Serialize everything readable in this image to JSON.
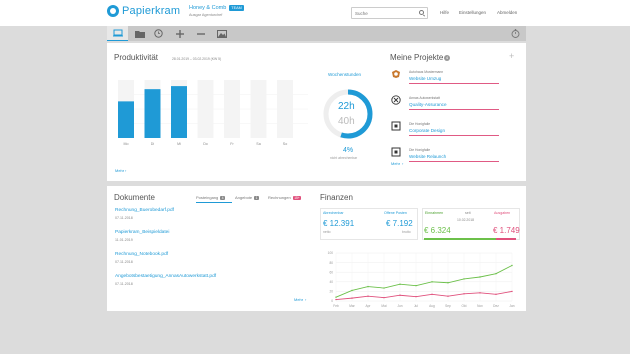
{
  "app": {
    "name": "Papierkram"
  },
  "company": {
    "name": "Honey & Comb",
    "plan": "TEAM",
    "subtitle": "Ausgar Agenturchef"
  },
  "search": {
    "placeholder": "Suche"
  },
  "nav": {
    "help": "Hilfe",
    "settings": "Einstellungen",
    "logout": "Abmelden"
  },
  "toolbar": {
    "icons": [
      "monitor-icon",
      "folder-icon",
      "clock-icon",
      "plus-icon",
      "minus-icon",
      "image-icon",
      "stopwatch-icon"
    ]
  },
  "productivity": {
    "title": "Produktivität",
    "range": "28.01.2019 – 03.02.2019 (KW 5)",
    "more": "Mehr",
    "weekly_title": "Wochenstunden",
    "hours_done": "22h",
    "hours_target": "40h",
    "percent": "4%",
    "percent_label": "nicht abrechenbar",
    "donut_fraction": 0.55
  },
  "chart_data": [
    {
      "type": "bar",
      "categories": [
        "Mo",
        "Di",
        "Mi",
        "Do",
        "Fr",
        "Sa",
        "So"
      ],
      "series": [
        {
          "values": [
            6,
            8,
            8.5,
            0,
            0,
            0,
            0
          ]
        }
      ],
      "ylim": [
        0,
        9.5
      ],
      "grid": true
    },
    {
      "type": "line",
      "categories": [
        "Feb",
        "Mar",
        "Apr",
        "Mai",
        "Jun",
        "Jul",
        "Aug",
        "Sep",
        "Okt",
        "Nov",
        "Dez",
        "Jan"
      ],
      "y_ticks": [
        0,
        20,
        40,
        60,
        80,
        100
      ],
      "series": [
        {
          "values": [
            8,
            22,
            30,
            27,
            35,
            32,
            40,
            38,
            46,
            50,
            57,
            74
          ]
        },
        {
          "values": [
            3,
            6,
            10,
            7,
            12,
            9,
            14,
            10,
            15,
            17,
            14,
            20
          ]
        }
      ],
      "ylim": [
        0,
        100
      ],
      "grid": true
    }
  ],
  "projects": {
    "title": "Meine Projekte",
    "count": "4",
    "more": "Mehr",
    "items": [
      {
        "client": "Autohaus Mustermann",
        "name": "Website Umzug"
      },
      {
        "client": "Annas Autowerkstatt",
        "name": "Quality-Assurance"
      },
      {
        "client": "Die Honigfalle",
        "name": "Corporate Design"
      },
      {
        "client": "Die Honigfalle",
        "name": "Website Relaunch"
      }
    ]
  },
  "documents": {
    "title": "Dokumente",
    "tabs": [
      {
        "label": "Posteingang",
        "count": "4"
      },
      {
        "label": "Angebote",
        "count": "1"
      },
      {
        "label": "Rechnungen",
        "count": "15+"
      }
    ],
    "items": [
      {
        "name": "Rechnung_Buerobedarf.pdf",
        "date": "07.11.2018"
      },
      {
        "name": "Papierkram_Beispieldatei",
        "date": "11.01.2019"
      },
      {
        "name": "Rechnung_Notebook.pdf",
        "date": "07.11.2018"
      },
      {
        "name": "Angebotsbestaetigung_AnnasAutowerkstatt.pdf",
        "date": "07.11.2018"
      }
    ],
    "more": "Mehr"
  },
  "finance": {
    "title": "Finanzen",
    "receivables_label": "Abrechenbar",
    "receivables": "€ 12.391",
    "receivables_sub": "netto",
    "open_label": "Offene Posten",
    "open_value": "€ 7.192",
    "open_sub": "brutto",
    "income_label": "Einnahmen",
    "since_label": "seit",
    "since_date": "10.02.2018",
    "expenses_label": "Ausgaben",
    "income": "€ 6.324",
    "expenses": "€ 1.749",
    "income_fraction": 0.78,
    "colors": {
      "income": "#6cc04a",
      "expenses": "#e0507c",
      "accent": "#1f9ad6"
    }
  }
}
